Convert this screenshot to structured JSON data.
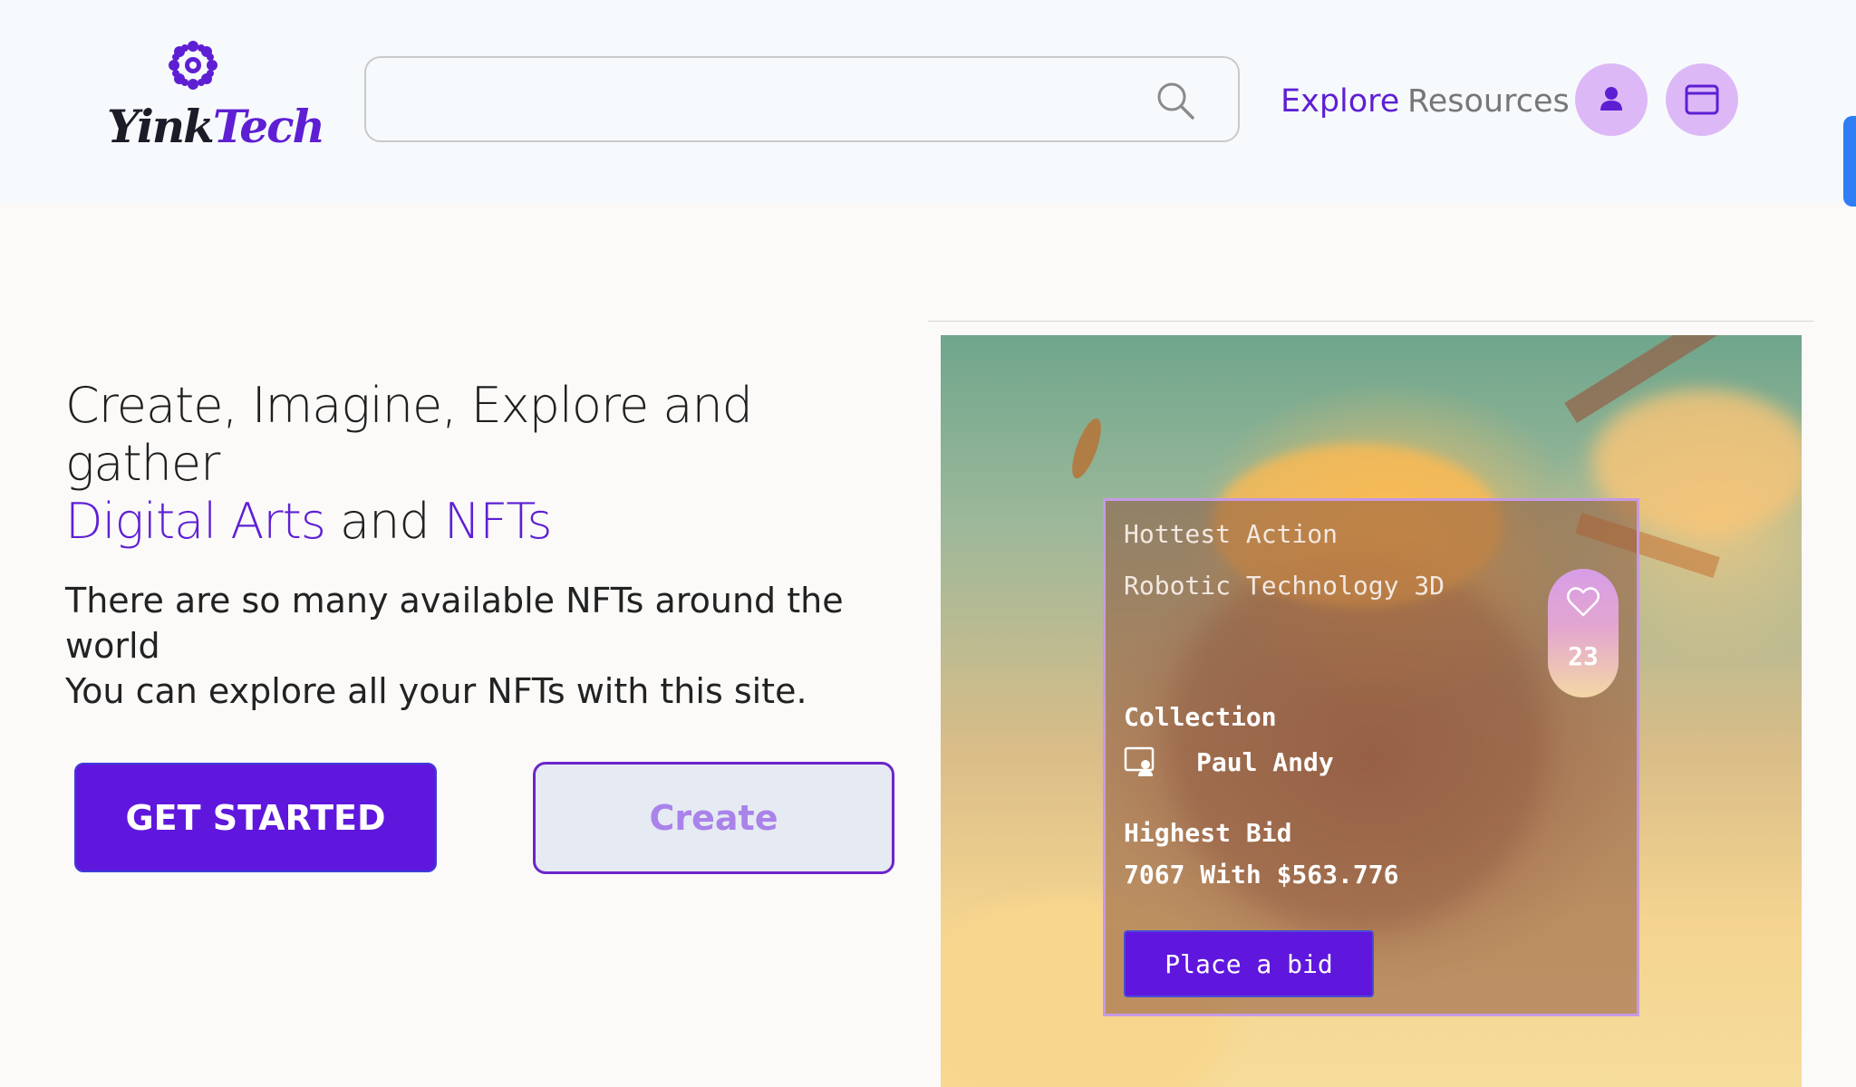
{
  "header": {
    "logo": {
      "text_primary": "Yink",
      "text_accent": "Tech",
      "icon": "sun-burst-icon"
    },
    "search": {
      "value": "",
      "placeholder": "",
      "icon": "search-icon"
    },
    "nav": [
      {
        "label": "Explore",
        "active": true
      },
      {
        "label": "Resources",
        "active": false
      }
    ],
    "actions": [
      {
        "icon": "user-icon"
      },
      {
        "icon": "wallet-icon"
      }
    ]
  },
  "hero": {
    "headline_line1": "Create, Imagine, Explore and gather",
    "headline_accent1": "Digital Arts",
    "headline_mid": "and",
    "headline_accent2": "NFTs",
    "subtext_line1": "There are so many available NFTs around the world",
    "subtext_line2": "You can explore all your NFTs with this site.",
    "primary_button": "GET STARTED",
    "secondary_button": "Create"
  },
  "nft_card": {
    "title": "Hottest Action",
    "name": "Robotic Technology 3D",
    "likes": "23",
    "collection_label": "Collection",
    "collection_owner": "Paul Andy",
    "collection_icon": "profile-card-icon",
    "bid_label": "Highest Bid",
    "bid_value": "7067 With $563.776",
    "bid_button": "Place a bid"
  },
  "colors": {
    "accent": "#5e1fd4",
    "primary_button": "#5f17dd",
    "circle_button": "#dcb9f6",
    "edge_tab": "#2f7ef5"
  }
}
